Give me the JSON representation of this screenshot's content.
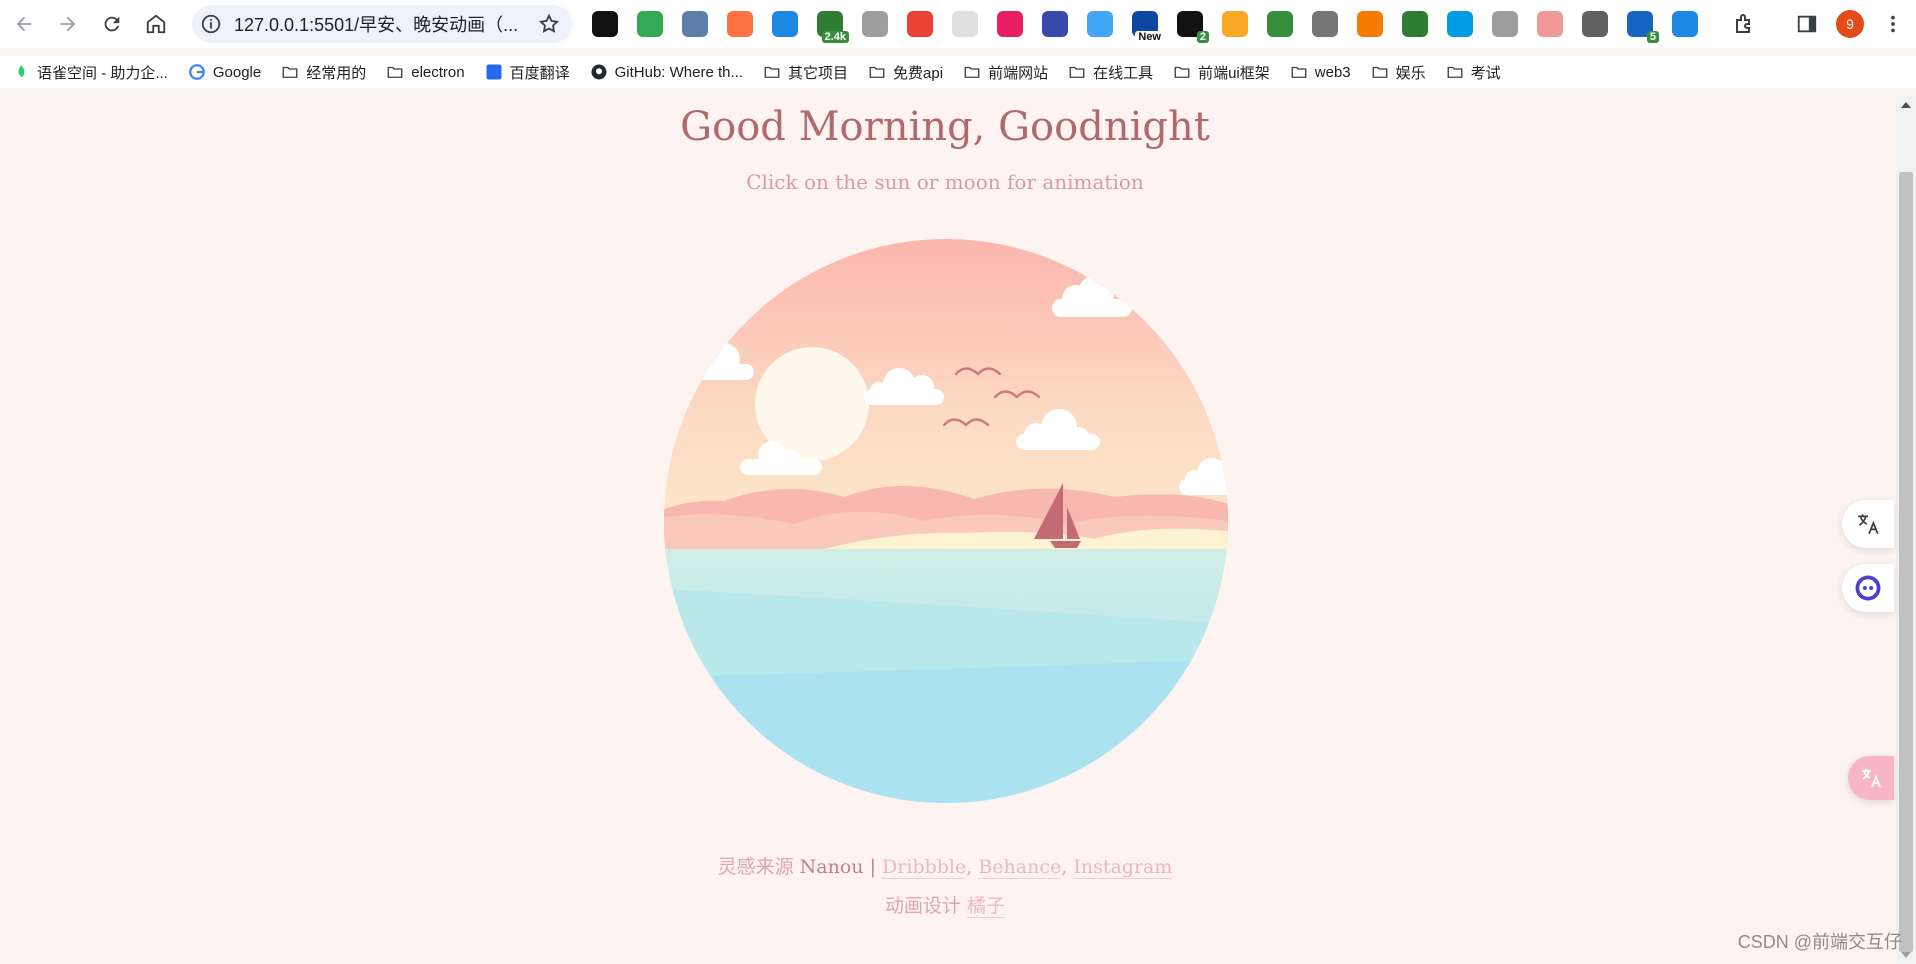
{
  "browser": {
    "url": "127.0.0.1:5501/早安、晚安动画（...",
    "profile_initial": "9",
    "extensions": [
      {
        "icon": "game-controller-icon",
        "color": "#111111",
        "badge": ""
      },
      {
        "icon": "shield-check-icon",
        "color": "#34a853",
        "badge": ""
      },
      {
        "icon": "star-box-icon",
        "color": "#5b7fa6",
        "badge": ""
      },
      {
        "icon": "orange-dots-icon",
        "color": "#ff7043",
        "badge": ""
      },
      {
        "icon": "shield-color-icon",
        "color": "#1e88e5",
        "badge": ""
      },
      {
        "icon": "lock-badge-icon",
        "color": "#2e7d32",
        "badge": "2.4k"
      },
      {
        "icon": "gamepad-outline-icon",
        "color": "#9e9e9e",
        "badge": ""
      },
      {
        "icon": "chrome-color-icon",
        "color": "#ea4335",
        "badge": ""
      },
      {
        "icon": "grid-faded-icon",
        "color": "#e0e0e0",
        "badge": ""
      },
      {
        "icon": "translate-pink-icon",
        "color": "#e91e63",
        "badge": ""
      },
      {
        "icon": "robot-face-icon",
        "color": "#3949ab",
        "badge": ""
      },
      {
        "icon": "camera-lens-icon",
        "color": "#42a5f5",
        "badge": ""
      },
      {
        "icon": "new-label-icon",
        "color": "#0d47a1",
        "badge": "New"
      },
      {
        "icon": "black-box-icon",
        "color": "#111111",
        "badge": "2"
      },
      {
        "icon": "y-letter-icon",
        "color": "#f9a825",
        "badge": ""
      },
      {
        "icon": "circle-color-icon",
        "color": "#388e3c",
        "badge": ""
      },
      {
        "icon": "document-copy-icon",
        "color": "#757575",
        "badge": ""
      },
      {
        "icon": "fox-icon",
        "color": "#f57c00",
        "badge": ""
      },
      {
        "icon": "download-arrow-icon",
        "color": "#2e7d32",
        "badge": ""
      },
      {
        "icon": "eye-icon",
        "color": "#039be5",
        "badge": ""
      },
      {
        "icon": "n-letter-icon",
        "color": "#9e9e9e",
        "badge": ""
      },
      {
        "icon": "firework-icon",
        "color": "#ef9a9a",
        "badge": ""
      },
      {
        "icon": "a-letter-icon",
        "color": "#616161",
        "badge": ""
      },
      {
        "icon": "blue-square-icon",
        "color": "#1565c0",
        "badge": "5"
      },
      {
        "icon": "person-blue-icon",
        "color": "#1e88e5",
        "badge": ""
      }
    ]
  },
  "bookmarks": [
    {
      "label": "语雀空间 - 助力企...",
      "icon": "yuque-icon"
    },
    {
      "label": "Google",
      "icon": "google-icon"
    },
    {
      "label": "经常用的",
      "icon": "folder-icon"
    },
    {
      "label": "electron",
      "icon": "folder-icon"
    },
    {
      "label": "百度翻译",
      "icon": "baidu-translate-icon"
    },
    {
      "label": "GitHub: Where th...",
      "icon": "github-icon"
    },
    {
      "label": "其它项目",
      "icon": "folder-icon"
    },
    {
      "label": "免费api",
      "icon": "folder-icon"
    },
    {
      "label": "前端网站",
      "icon": "folder-icon"
    },
    {
      "label": "在线工具",
      "icon": "folder-icon"
    },
    {
      "label": "前端ui框架",
      "icon": "folder-icon"
    },
    {
      "label": "web3",
      "icon": "folder-icon"
    },
    {
      "label": "娱乐",
      "icon": "folder-icon"
    },
    {
      "label": "考试",
      "icon": "folder-icon"
    }
  ],
  "page": {
    "title": "Good Morning, Goodnight",
    "subtitle": "Click on the sun or moon for animation",
    "credit_prefix": "灵感来源",
    "credit_name": "Nanou",
    "credit_sep": "|",
    "credit_links": [
      "Dribbble",
      "Behance",
      "Instagram"
    ],
    "design_prefix": "动画设计",
    "design_name": "橘子"
  },
  "watermark": "CSDN @前端交互仔",
  "colors": {
    "background": "#fdf3f0",
    "title": "#b06a6e",
    "sky_top": "#fbb8b0",
    "sky_bottom": "#fde6c8",
    "sea_top": "#c9ede6",
    "sea_bottom": "#aee1ef",
    "sailboat": "#c46a72"
  }
}
